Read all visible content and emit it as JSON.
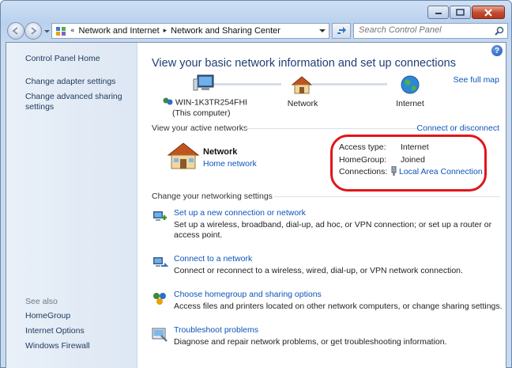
{
  "address": {
    "overflow_glyph": "«",
    "segments": [
      "Network and Internet",
      "Network and Sharing Center"
    ],
    "separator": "▸"
  },
  "search": {
    "placeholder": "Search Control Panel"
  },
  "sidebar": {
    "items": [
      {
        "label": "Control Panel Home"
      },
      {
        "label": "Change adapter settings"
      },
      {
        "label": "Change advanced sharing settings"
      }
    ],
    "see_also_label": "See also",
    "see_also": [
      {
        "label": "HomeGroup"
      },
      {
        "label": "Internet Options"
      },
      {
        "label": "Windows Firewall"
      }
    ]
  },
  "main": {
    "title": "View your basic network information and set up connections",
    "see_full_map": "See full map",
    "map": {
      "computer_name": "WIN-1K3TR254FHI",
      "computer_sub": "(This computer)",
      "network": "Network",
      "internet": "Internet"
    },
    "active_networks_label": "View your active networks",
    "connect_disconnect": "Connect or disconnect",
    "active_network": {
      "name": "Network",
      "type": "Home network",
      "access_type_key": "Access type:",
      "access_type_value": "Internet",
      "homegroup_key": "HomeGroup:",
      "homegroup_value": "Joined",
      "connections_key": "Connections:",
      "connections_value": "Local Area Connection"
    },
    "settings_label": "Change your networking settings",
    "tasks": [
      {
        "title": "Set up a new connection or network",
        "desc": "Set up a wireless, broadband, dial-up, ad hoc, or VPN connection; or set up a router or access point.",
        "icon": "new-connection-icon"
      },
      {
        "title": "Connect to a network",
        "desc": "Connect or reconnect to a wireless, wired, dial-up, or VPN network connection.",
        "icon": "connect-network-icon"
      },
      {
        "title": "Choose homegroup and sharing options",
        "desc": "Access files and printers located on other network computers, or change sharing settings.",
        "icon": "homegroup-icon"
      },
      {
        "title": "Troubleshoot problems",
        "desc": "Diagnose and repair network problems, or get troubleshooting information.",
        "icon": "troubleshoot-icon"
      }
    ]
  },
  "colors": {
    "link": "#0c54b8",
    "title": "#1e3f73",
    "highlight": "#e0161b",
    "close_button": "#c14a2e"
  }
}
